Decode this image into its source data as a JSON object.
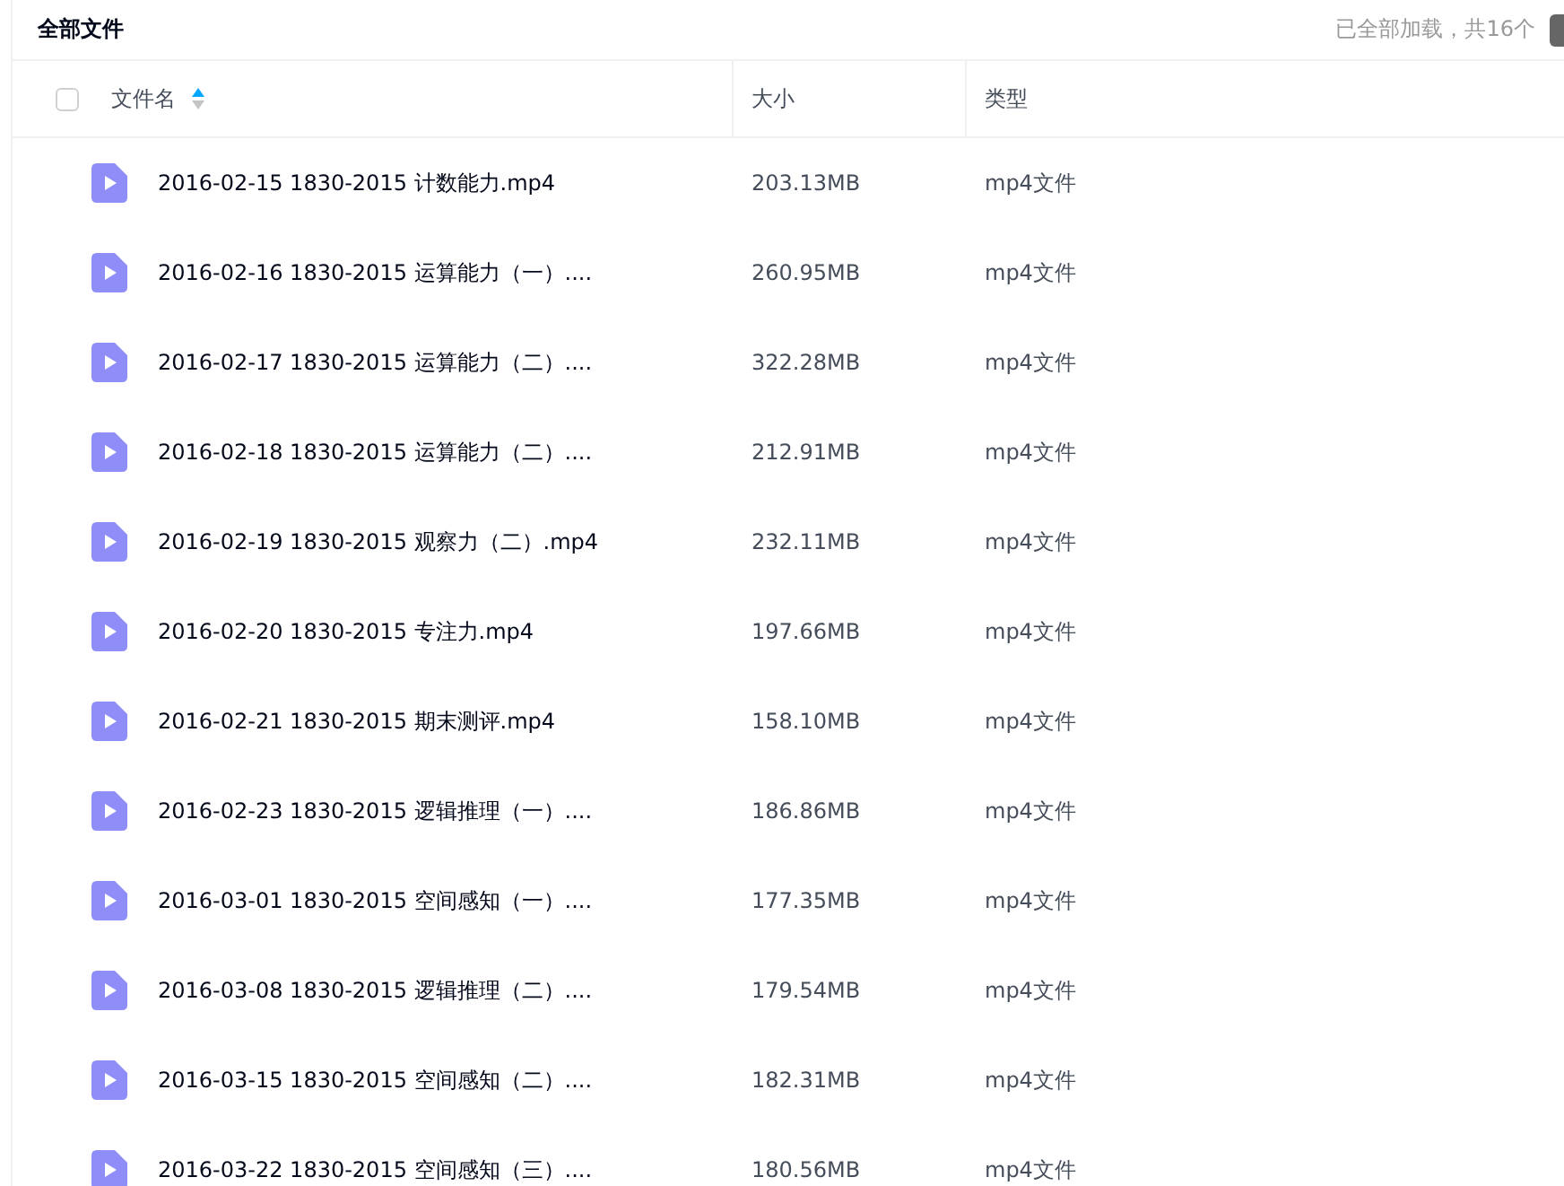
{
  "title": "全部文件",
  "load_status": "已全部加载，共16个",
  "table": {
    "select_all": {
      "checked": false
    },
    "columns": [
      {
        "label": "文件名",
        "sorted_ascending": true
      },
      {
        "label": "大小"
      },
      {
        "label": "类型"
      }
    ],
    "rows": [
      {
        "name": "2016-02-15 1830-2015 计数能力.mp4",
        "size": "203.13MB",
        "type": "mp4文件"
      },
      {
        "name": "2016-02-16 1830-2015 运算能力（一）....",
        "size": "260.95MB",
        "type": "mp4文件"
      },
      {
        "name": "2016-02-17 1830-2015 运算能力（二）....",
        "size": "322.28MB",
        "type": "mp4文件"
      },
      {
        "name": "2016-02-18 1830-2015 运算能力（二）....",
        "size": "212.91MB",
        "type": "mp4文件"
      },
      {
        "name": "2016-02-19 1830-2015 观察力（二）.mp4",
        "size": "232.11MB",
        "type": "mp4文件"
      },
      {
        "name": "2016-02-20 1830-2015 专注力.mp4",
        "size": "197.66MB",
        "type": "mp4文件"
      },
      {
        "name": "2016-02-21 1830-2015 期末测评.mp4",
        "size": "158.10MB",
        "type": "mp4文件"
      },
      {
        "name": "2016-02-23 1830-2015 逻辑推理（一）....",
        "size": "186.86MB",
        "type": "mp4文件"
      },
      {
        "name": "2016-03-01 1830-2015 空间感知（一）....",
        "size": "177.35MB",
        "type": "mp4文件"
      },
      {
        "name": "2016-03-08 1830-2015 逻辑推理（二）....",
        "size": "179.54MB",
        "type": "mp4文件"
      },
      {
        "name": "2016-03-15 1830-2015 空间感知（二）....",
        "size": "182.31MB",
        "type": "mp4文件"
      },
      {
        "name": "2016-03-22 1830-2015 空间感知（三）....",
        "size": "180.56MB",
        "type": "mp4文件"
      }
    ]
  }
}
